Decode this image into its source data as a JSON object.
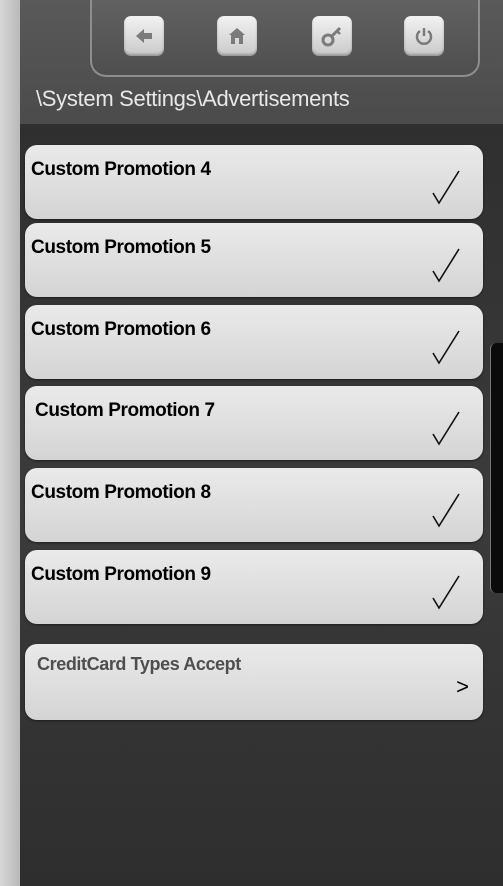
{
  "toolbar": {
    "buttons": [
      {
        "icon": "back-arrow-icon"
      },
      {
        "icon": "home-icon"
      },
      {
        "icon": "key-icon"
      },
      {
        "icon": "power-icon"
      }
    ]
  },
  "breadcrumb": "\\System Settings\\Advertisements",
  "items": [
    {
      "label": "Custom Promotion 4",
      "status": "√"
    },
    {
      "label": "Custom Promotion 5",
      "status": "√"
    },
    {
      "label": "Custom Promotion 6",
      "status": "√"
    },
    {
      "label": "Custom Promotion 7",
      "status": "√"
    },
    {
      "label": "Custom Promotion 8",
      "status": "√"
    },
    {
      "label": "Custom Promotion 9",
      "status": "√"
    }
  ],
  "nav_item": {
    "label": "CreditCard Types Accept",
    "chevron": ">"
  },
  "colors": {
    "icon_gray": "#7a7a7a",
    "row_bg": "#e2e2e2",
    "background": "#333333"
  }
}
